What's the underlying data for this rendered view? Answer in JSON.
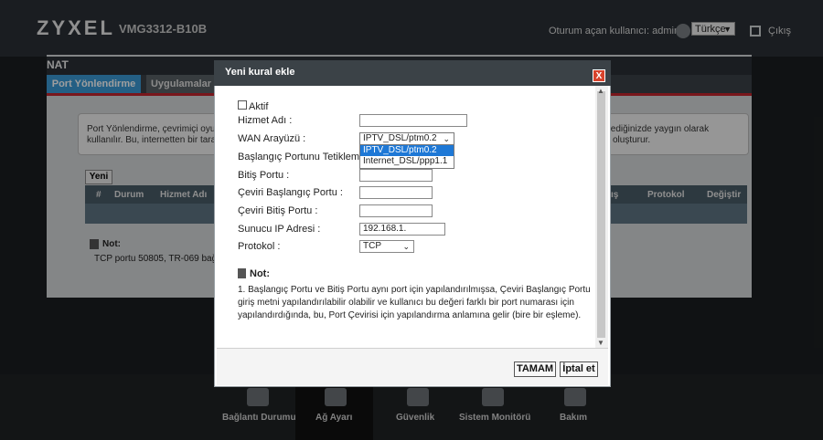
{
  "header": {
    "brand": "ZYXEL",
    "model": "VMG3312-B10B",
    "user_label": "Oturum açan kullanıcı:  admin",
    "language": "Türkçe",
    "logout": "Çıkış"
  },
  "page": {
    "title": "NAT",
    "tabs": [
      {
        "label": "Port Yönlendirme"
      },
      {
        "label": "Uygulamalar"
      }
    ],
    "desc_left": [
      "Port Yönlendirme, çevrimiçi oyun",
      "kullanılır. Bu, internetten bir tarafı"
    ],
    "desc_right": [
      "tediğinizde yaygın olarak",
      "oluşturur."
    ],
    "new_button": "Yeni",
    "table_headers": [
      "#",
      "Durum",
      "Hizmet Adı",
      "Protokol",
      "Değiştir"
    ],
    "table_header_partial": "ış",
    "note_label": "Not:",
    "note_text": "TCP portu 50805, TR-069 bağlı"
  },
  "nav": {
    "items": [
      {
        "label": "Bağlantı Durumu"
      },
      {
        "label": "Ağ Ayarı"
      },
      {
        "label": "Güvenlik"
      },
      {
        "label": "Sistem Monitörü"
      },
      {
        "label": "Bakım"
      }
    ]
  },
  "dialog": {
    "title": "Yeni kural ekle",
    "close": "X",
    "active_label": "Aktif",
    "active_checked": false,
    "fields": {
      "service_name": {
        "label": "Hizmet Adı :",
        "value": ""
      },
      "wan": {
        "label": "WAN Arayüzü :",
        "value": "IPTV_DSL/ptm0.2",
        "options": [
          "IPTV_DSL/ptm0.2",
          "Internet_DSL/ppp1.1"
        ]
      },
      "start_port": {
        "label": "Başlangıç Portunu Tetikleme :",
        "value": ""
      },
      "end_port": {
        "label": "Bitiş Portu :",
        "value": ""
      },
      "translate_start": {
        "label": "Çeviri Başlangıç Portu :",
        "value": ""
      },
      "translate_end": {
        "label": "Çeviri Bitiş Portu :",
        "value": ""
      },
      "server_ip": {
        "label": "Sunucu IP Adresi :",
        "value": "192.168.1."
      },
      "protocol": {
        "label": "Protokol :",
        "value": "TCP"
      }
    },
    "note_title": "Not:",
    "note_lines": [
      "1.   Başlangıç Portu ve Bitiş Portu aynı port için yapılandırılmışsa, Çeviri Başlangıç Portu",
      "giriş metni yapılandırılabilir olabilir ve kullanıcı bu değeri farklı bir port numarası için",
      "yapılandırdığında, bu, Port Çevirisi için yapılandırma anlamına gelir (bire bir eşleme)."
    ],
    "ok": "TAMAM",
    "cancel": "İptal et"
  }
}
